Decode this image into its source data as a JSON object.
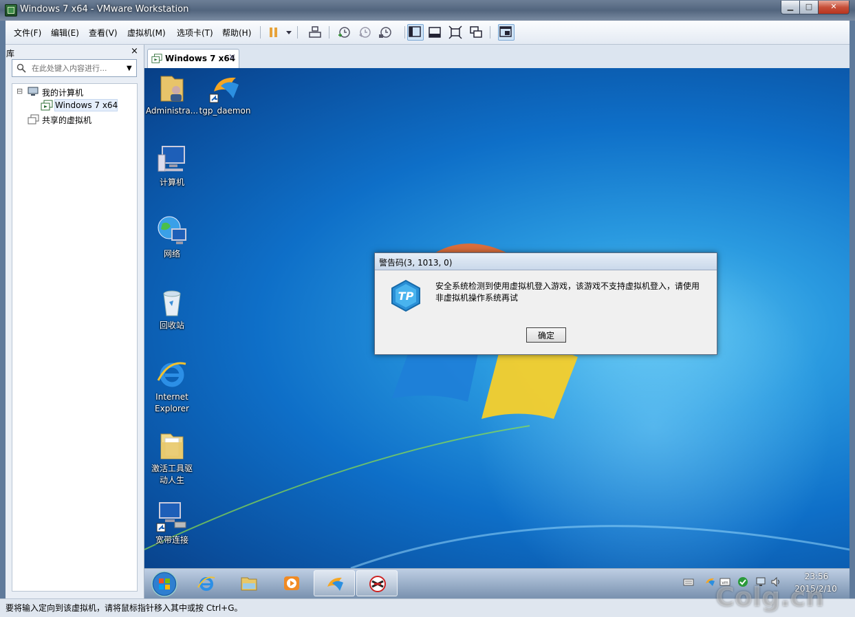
{
  "window": {
    "title": "Windows 7 x64 - VMware Workstation",
    "minimize": "▁",
    "maximize": "□",
    "close": "✕"
  },
  "menu": [
    "文件(F)",
    "编辑(E)",
    "查看(V)",
    "虚拟机(M)",
    "选项卡(T)",
    "帮助(H)"
  ],
  "library": {
    "title": "库",
    "close": "×",
    "search_placeholder": "在此处键入内容进行...",
    "tree": {
      "my_computer": "我的计算机",
      "vm": "Windows 7 x64",
      "shared": "共享的虚拟机",
      "collapse": "⊟"
    }
  },
  "tab": {
    "label": "Windows 7 x64",
    "close": "×"
  },
  "desktop_icons": [
    {
      "label": "Administra...",
      "icon": "user-folder-icon"
    },
    {
      "label": "tgp_daemon",
      "icon": "tgp-icon"
    },
    {
      "label": "计算机",
      "icon": "computer-icon"
    },
    {
      "label": "网络",
      "icon": "network-icon"
    },
    {
      "label": "回收站",
      "icon": "recycle-bin-icon"
    },
    {
      "label": "Internet Explorer",
      "icon": "ie-icon"
    },
    {
      "label": "激活工具驱动人生",
      "icon": "folder-icon"
    },
    {
      "label": "宽带连接",
      "icon": "broadband-icon"
    }
  ],
  "dialog": {
    "title": "警告码(3, 1013, 0)",
    "message": "安全系统检测到使用虚拟机登入游戏，该游戏不支持虚拟机登入，请使用非虚拟机操作系统再试",
    "ok_label": "确定"
  },
  "taskbar": {
    "time": "23:56",
    "date": "2015/2/10"
  },
  "statusbar": {
    "text": "要将输入定向到该虚拟机，请将鼠标指针移入其中或按 Ctrl+G。"
  },
  "watermark": "Colg.cn",
  "colors": {
    "desktop": "#0e6fc8",
    "accent": "#7aa7d4",
    "close_red": "#c7503a"
  }
}
